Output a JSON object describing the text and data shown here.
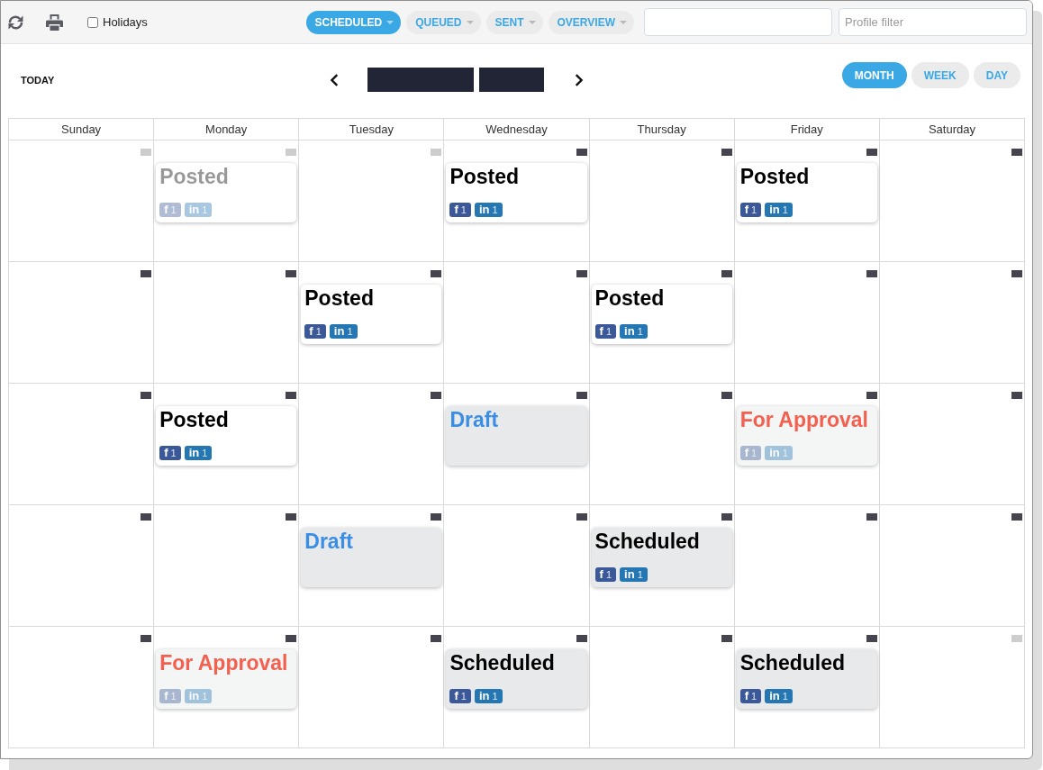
{
  "toolbar": {
    "holidays": {
      "label": "Holidays",
      "checked": false
    },
    "filters": [
      {
        "label": "SCHEDULED",
        "selected": true
      },
      {
        "label": "QUEUED",
        "selected": false
      },
      {
        "label": "SENT",
        "selected": false
      },
      {
        "label": "OVERVIEW",
        "selected": false
      }
    ],
    "profile_filter": {
      "placeholder": "Profile filter"
    }
  },
  "calendar": {
    "today_button": "TODAY",
    "views": [
      {
        "label": "MONTH",
        "selected": true
      },
      {
        "label": "WEEK",
        "selected": false
      },
      {
        "label": "DAY",
        "selected": false
      }
    ],
    "weekdays": [
      "Sunday",
      "Monday",
      "Tuesday",
      "Wednesday",
      "Thursday",
      "Friday",
      "Saturday"
    ],
    "weeks": [
      {
        "days": [
          {
            "other_month": true
          },
          {
            "other_month": true,
            "events": [
              {
                "kind": "posted",
                "title": "Posted",
                "dimmed": true,
                "badges": [
                  {
                    "kind": "facebook",
                    "label": "**f** 1"
                  },
                  {
                    "kind": "linkedin",
                    "label": "**in** 1"
                  }
                ]
              }
            ]
          },
          {
            "other_month": true
          },
          {
            "other_month": false,
            "events": [
              {
                "kind": "posted",
                "title": "Posted",
                "dimmed": false,
                "badges": [
                  {
                    "kind": "facebook",
                    "label": "**f** 1"
                  },
                  {
                    "kind": "linkedin",
                    "label": "**in** 1"
                  }
                ]
              }
            ]
          },
          {
            "other_month": false
          },
          {
            "other_month": false,
            "events": [
              {
                "kind": "posted",
                "title": "Posted",
                "dimmed": false,
                "badges": [
                  {
                    "kind": "facebook",
                    "label": "**f** 1"
                  },
                  {
                    "kind": "linkedin",
                    "label": "**in** 1"
                  }
                ]
              }
            ]
          },
          {
            "other_month": false
          }
        ]
      },
      {
        "days": [
          {
            "other_month": false
          },
          {
            "other_month": false
          },
          {
            "other_month": false,
            "events": [
              {
                "kind": "posted",
                "title": "Posted",
                "dimmed": false,
                "badges": [
                  {
                    "kind": "facebook",
                    "label": "**f** 1"
                  },
                  {
                    "kind": "linkedin",
                    "label": "**in** 1"
                  }
                ]
              }
            ]
          },
          {
            "other_month": false
          },
          {
            "other_month": false,
            "events": [
              {
                "kind": "posted",
                "title": "Posted",
                "dimmed": false,
                "badges": [
                  {
                    "kind": "facebook",
                    "label": "**f** 1"
                  },
                  {
                    "kind": "linkedin",
                    "label": "**in** 1"
                  }
                ]
              }
            ]
          },
          {
            "other_month": false
          },
          {
            "other_month": false
          }
        ]
      },
      {
        "days": [
          {
            "other_month": false
          },
          {
            "other_month": false,
            "events": [
              {
                "kind": "posted",
                "title": "Posted",
                "dimmed": false,
                "badges": [
                  {
                    "kind": "facebook",
                    "label": "**f** 1"
                  },
                  {
                    "kind": "linkedin",
                    "label": "**in** 1"
                  }
                ]
              }
            ]
          },
          {
            "other_month": false
          },
          {
            "other_month": false,
            "events": [
              {
                "kind": "draft",
                "title": "Draft",
                "dimmed": false
              }
            ]
          },
          {
            "other_month": false
          },
          {
            "other_month": false,
            "events": [
              {
                "kind": "for_approval",
                "title": "For Approval",
                "dimmed": false,
                "badges": [
                  {
                    "kind": "facebook",
                    "label": "**f** 1"
                  },
                  {
                    "kind": "linkedin",
                    "label": "**in** 1"
                  }
                ]
              }
            ]
          },
          {
            "other_month": false
          }
        ]
      },
      {
        "days": [
          {
            "other_month": false
          },
          {
            "other_month": false
          },
          {
            "other_month": false,
            "events": [
              {
                "kind": "draft",
                "title": "Draft",
                "dimmed": false
              }
            ]
          },
          {
            "other_month": false
          },
          {
            "other_month": false,
            "events": [
              {
                "kind": "scheduled",
                "title": "Scheduled",
                "dimmed": false,
                "badges": [
                  {
                    "kind": "facebook",
                    "label": "**f** 1"
                  },
                  {
                    "kind": "linkedin",
                    "label": "**in** 1"
                  }
                ]
              }
            ]
          },
          {
            "other_month": false
          },
          {
            "other_month": false
          }
        ]
      },
      {
        "days": [
          {
            "other_month": false
          },
          {
            "other_month": false,
            "events": [
              {
                "kind": "for_approval",
                "title": "For Approval",
                "dimmed": false,
                "badges": [
                  {
                    "kind": "facebook",
                    "label": "**f** 1"
                  },
                  {
                    "kind": "linkedin",
                    "label": "**in** 1"
                  }
                ]
              }
            ]
          },
          {
            "other_month": false
          },
          {
            "other_month": false,
            "events": [
              {
                "kind": "scheduled",
                "title": "Scheduled",
                "dimmed": false,
                "badges": [
                  {
                    "kind": "facebook",
                    "label": "**f** 1"
                  },
                  {
                    "kind": "linkedin",
                    "label": "**in** 1"
                  }
                ]
              }
            ]
          },
          {
            "other_month": false
          },
          {
            "other_month": false,
            "events": [
              {
                "kind": "scheduled",
                "title": "Scheduled",
                "dimmed": false,
                "badges": [
                  {
                    "kind": "facebook",
                    "label": "**f** 1"
                  },
                  {
                    "kind": "linkedin",
                    "label": "**in** 1"
                  }
                ]
              }
            ]
          },
          {
            "other_month": true
          }
        ]
      }
    ]
  }
}
